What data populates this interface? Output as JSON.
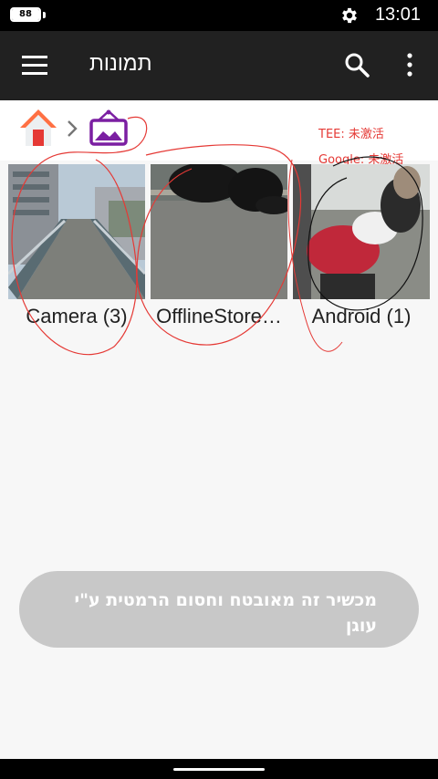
{
  "status_bar": {
    "battery_level": "88",
    "clock": "13:01",
    "icons": [
      "battery-icon",
      "gear-icon"
    ]
  },
  "app_bar": {
    "title": "תמונות",
    "icons": [
      "menu-icon",
      "search-icon",
      "more-vert-icon"
    ]
  },
  "breadcrumb": {
    "icons": [
      "home-icon",
      "chevron-right-icon",
      "gallery-icon"
    ]
  },
  "activation": {
    "tee": "TEE: 未激活",
    "google": "Google: 未激活"
  },
  "albums": [
    {
      "label": "Camera (3)"
    },
    {
      "label": "OfflineStore…"
    },
    {
      "label": "Android (1)"
    }
  ],
  "toast": {
    "message": "מכשיר זה מאובטח וחסום הרמטית ע\"י עוגן"
  },
  "colors": {
    "app_bar": "#212121",
    "status_red": "#e53935",
    "gallery_purple": "#7b1fa2",
    "toast_bg": "#c8c8c8"
  }
}
